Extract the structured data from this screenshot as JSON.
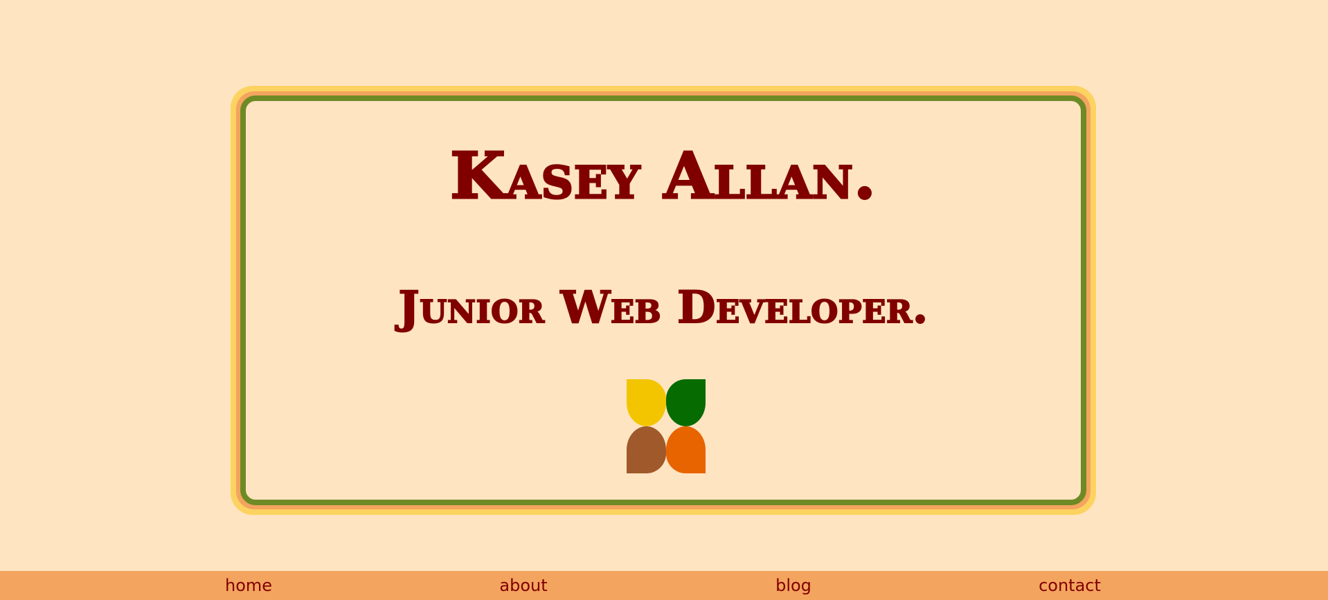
{
  "hero": {
    "name": "Kasey Allan.",
    "role": "Junior Web Developer."
  },
  "logo": {
    "icon": "four-petal-logo-icon",
    "colors": [
      "#f2c500",
      "#066b00",
      "#a0592a",
      "#e76400"
    ]
  },
  "nav": {
    "items": [
      {
        "label": "home"
      },
      {
        "label": "about"
      },
      {
        "label": "blog"
      },
      {
        "label": "contact"
      }
    ]
  },
  "colors": {
    "background": "#ffe4c2",
    "text": "#800000",
    "frame_yellow": "#fcd360",
    "frame_orange": "#f3a45f",
    "frame_green": "#6e8a25",
    "nav_background": "#f3a45f"
  }
}
